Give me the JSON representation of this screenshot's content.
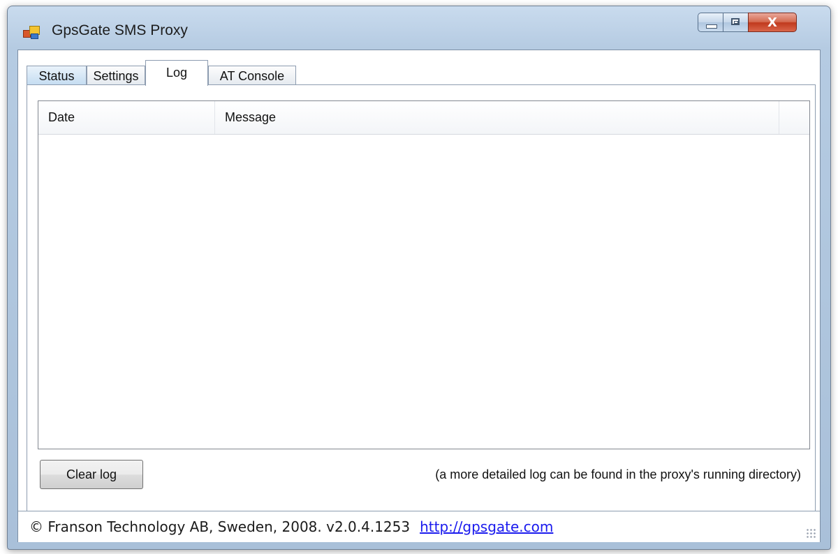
{
  "window": {
    "title": "GpsGate SMS Proxy",
    "icon": "gpsgate-app-icon",
    "controls": {
      "minimize_icon": "minimize-icon",
      "maximize_icon": "maximize-icon",
      "close_icon": "close-icon",
      "close_glyph": "X"
    }
  },
  "tabs": [
    {
      "label": "Status"
    },
    {
      "label": "Settings"
    },
    {
      "label": "Log",
      "selected": true
    },
    {
      "label": "AT Console"
    }
  ],
  "log": {
    "columns": [
      {
        "label": "Date"
      },
      {
        "label": "Message"
      }
    ],
    "rows": []
  },
  "actions": {
    "clear_label": "Clear log"
  },
  "note": "(a more detailed log can be found in the proxy's running directory)",
  "statusbar": {
    "text": "© Franson Technology AB, Sweden, 2008.  v2.0.4.1253",
    "link": "http://gpsgate.com"
  },
  "colors": {
    "frame": "#b5cbe2",
    "link": "#1a1aee",
    "close_button": "#c0391d"
  }
}
